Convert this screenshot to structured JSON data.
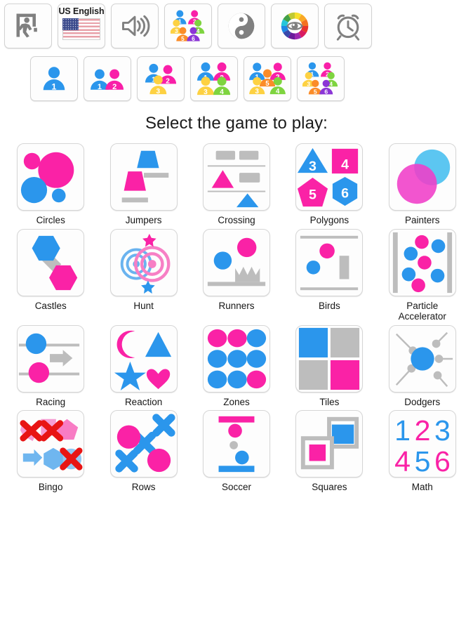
{
  "app": {
    "title_prompt": "Select the game to play:"
  },
  "colors": {
    "pink": "#fa22a6",
    "magenta": "#f91fa8",
    "blue": "#2b96ec",
    "gray": "#bdbdbd",
    "yellow": "#fdd142",
    "green": "#7ed43f",
    "orange": "#fb8c28",
    "purple": "#8b35d6",
    "red": "#e81414",
    "tile_border": "#d6d6d6",
    "tile_bg": "#fdfdfd",
    "text": "#161616"
  },
  "toolbar_top": [
    {
      "name": "exit",
      "icon": "exit-door-icon",
      "label": ""
    },
    {
      "name": "language",
      "icon": "us-flag-icon",
      "label": "US English"
    },
    {
      "name": "sound",
      "icon": "speaker-icon",
      "label": ""
    },
    {
      "name": "players",
      "icon": "six-players-icon",
      "label": ""
    },
    {
      "name": "difficulty",
      "icon": "yin-yang-icon",
      "label": ""
    },
    {
      "name": "colors",
      "icon": "color-wheel-eye-icon",
      "label": ""
    },
    {
      "name": "timer",
      "icon": "alarm-clock-icon",
      "label": ""
    }
  ],
  "toolbar_players": [
    {
      "name": "players-1",
      "count": 1,
      "selected": false
    },
    {
      "name": "players-2",
      "count": 2,
      "selected": false
    },
    {
      "name": "players-3",
      "count": 3,
      "selected": false
    },
    {
      "name": "players-4",
      "count": 4,
      "selected": false
    },
    {
      "name": "players-5",
      "count": 5,
      "selected": false
    },
    {
      "name": "players-6",
      "count": 6,
      "selected": false
    }
  ],
  "games": [
    {
      "id": "circles",
      "label": "Circles"
    },
    {
      "id": "jumpers",
      "label": "Jumpers"
    },
    {
      "id": "crossing",
      "label": "Crossing"
    },
    {
      "id": "polygons",
      "label": "Polygons",
      "numbers": [
        "3",
        "4",
        "5",
        "6"
      ]
    },
    {
      "id": "painters",
      "label": "Painters"
    },
    {
      "id": "castles",
      "label": "Castles"
    },
    {
      "id": "hunt",
      "label": "Hunt"
    },
    {
      "id": "runners",
      "label": "Runners"
    },
    {
      "id": "birds",
      "label": "Birds"
    },
    {
      "id": "particle",
      "label": "Particle Accelerator"
    },
    {
      "id": "racing",
      "label": "Racing"
    },
    {
      "id": "reaction",
      "label": "Reaction"
    },
    {
      "id": "zones",
      "label": "Zones"
    },
    {
      "id": "tiles",
      "label": "Tiles"
    },
    {
      "id": "dodgers",
      "label": "Dodgers"
    },
    {
      "id": "bingo",
      "label": "Bingo"
    },
    {
      "id": "rows",
      "label": "Rows"
    },
    {
      "id": "soccer",
      "label": "Soccer"
    },
    {
      "id": "squares",
      "label": "Squares"
    },
    {
      "id": "math",
      "label": "Math",
      "numbers": [
        "1",
        "2",
        "3",
        "4",
        "5",
        "6"
      ]
    }
  ]
}
